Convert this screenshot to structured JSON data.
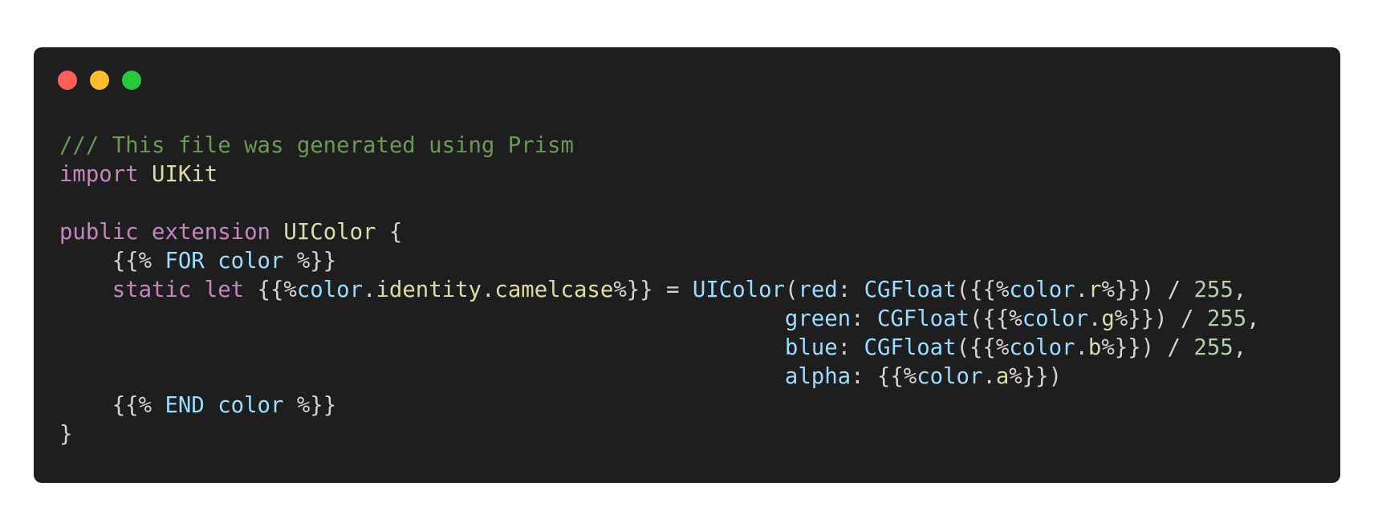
{
  "window": {
    "controls": [
      {
        "name": "close",
        "color": "#ff5f56"
      },
      {
        "name": "minimize",
        "color": "#ffbd2e"
      },
      {
        "name": "zoom",
        "color": "#27c93f"
      }
    ]
  },
  "colors": {
    "background": "#1e1e1e",
    "comment": "#6a9955",
    "keyword": "#c586c0",
    "type": "#dcdcaa",
    "identifier": "#9cdcfe",
    "number": "#b5cea8",
    "plain": "#d4d4d4"
  },
  "code": {
    "language": "swift",
    "lines": [
      [
        {
          "t": "comment",
          "v": "/// This file was generated using Prism"
        }
      ],
      [
        {
          "t": "keyword",
          "v": "import"
        },
        {
          "t": "plain",
          "v": " "
        },
        {
          "t": "type",
          "v": "UIKit"
        }
      ],
      [],
      [
        {
          "t": "keyword",
          "v": "public"
        },
        {
          "t": "plain",
          "v": " "
        },
        {
          "t": "keyword",
          "v": "extension"
        },
        {
          "t": "plain",
          "v": " "
        },
        {
          "t": "type",
          "v": "UIColor"
        },
        {
          "t": "plain",
          "v": " {"
        }
      ],
      [
        {
          "t": "plain",
          "v": "    {{% "
        },
        {
          "t": "ident",
          "v": "FOR color"
        },
        {
          "t": "plain",
          "v": " %}}"
        }
      ],
      [
        {
          "t": "plain",
          "v": "    "
        },
        {
          "t": "keyword",
          "v": "static"
        },
        {
          "t": "plain",
          "v": " "
        },
        {
          "t": "keyword",
          "v": "let"
        },
        {
          "t": "plain",
          "v": " {{%"
        },
        {
          "t": "ident",
          "v": "color"
        },
        {
          "t": "plain",
          "v": "."
        },
        {
          "t": "func",
          "v": "identity"
        },
        {
          "t": "plain",
          "v": "."
        },
        {
          "t": "func",
          "v": "camelcase"
        },
        {
          "t": "plain",
          "v": "%}} = "
        },
        {
          "t": "ident",
          "v": "UIColor"
        },
        {
          "t": "plain",
          "v": "("
        },
        {
          "t": "ident",
          "v": "red"
        },
        {
          "t": "plain",
          "v": ": "
        },
        {
          "t": "ident",
          "v": "CGFloat"
        },
        {
          "t": "plain",
          "v": "({{%"
        },
        {
          "t": "ident",
          "v": "color"
        },
        {
          "t": "plain",
          "v": "."
        },
        {
          "t": "func",
          "v": "r"
        },
        {
          "t": "plain",
          "v": "%}}) / "
        },
        {
          "t": "number",
          "v": "255"
        },
        {
          "t": "plain",
          "v": ","
        }
      ],
      [
        {
          "t": "plain",
          "v": "                                                       "
        },
        {
          "t": "ident",
          "v": "green"
        },
        {
          "t": "plain",
          "v": ": "
        },
        {
          "t": "ident",
          "v": "CGFloat"
        },
        {
          "t": "plain",
          "v": "({{%"
        },
        {
          "t": "ident",
          "v": "color"
        },
        {
          "t": "plain",
          "v": "."
        },
        {
          "t": "func",
          "v": "g"
        },
        {
          "t": "plain",
          "v": "%}}) / "
        },
        {
          "t": "number",
          "v": "255"
        },
        {
          "t": "plain",
          "v": ","
        }
      ],
      [
        {
          "t": "plain",
          "v": "                                                       "
        },
        {
          "t": "ident",
          "v": "blue"
        },
        {
          "t": "plain",
          "v": ": "
        },
        {
          "t": "ident",
          "v": "CGFloat"
        },
        {
          "t": "plain",
          "v": "({{%"
        },
        {
          "t": "ident",
          "v": "color"
        },
        {
          "t": "plain",
          "v": "."
        },
        {
          "t": "func",
          "v": "b"
        },
        {
          "t": "plain",
          "v": "%}}) / "
        },
        {
          "t": "number",
          "v": "255"
        },
        {
          "t": "plain",
          "v": ","
        }
      ],
      [
        {
          "t": "plain",
          "v": "                                                       "
        },
        {
          "t": "ident",
          "v": "alpha"
        },
        {
          "t": "plain",
          "v": ": {{%"
        },
        {
          "t": "ident",
          "v": "color"
        },
        {
          "t": "plain",
          "v": "."
        },
        {
          "t": "func",
          "v": "a"
        },
        {
          "t": "plain",
          "v": "%}})"
        }
      ],
      [
        {
          "t": "plain",
          "v": "    {{% "
        },
        {
          "t": "ident",
          "v": "END color"
        },
        {
          "t": "plain",
          "v": " %}}"
        }
      ],
      [
        {
          "t": "plain",
          "v": "}"
        }
      ]
    ]
  }
}
